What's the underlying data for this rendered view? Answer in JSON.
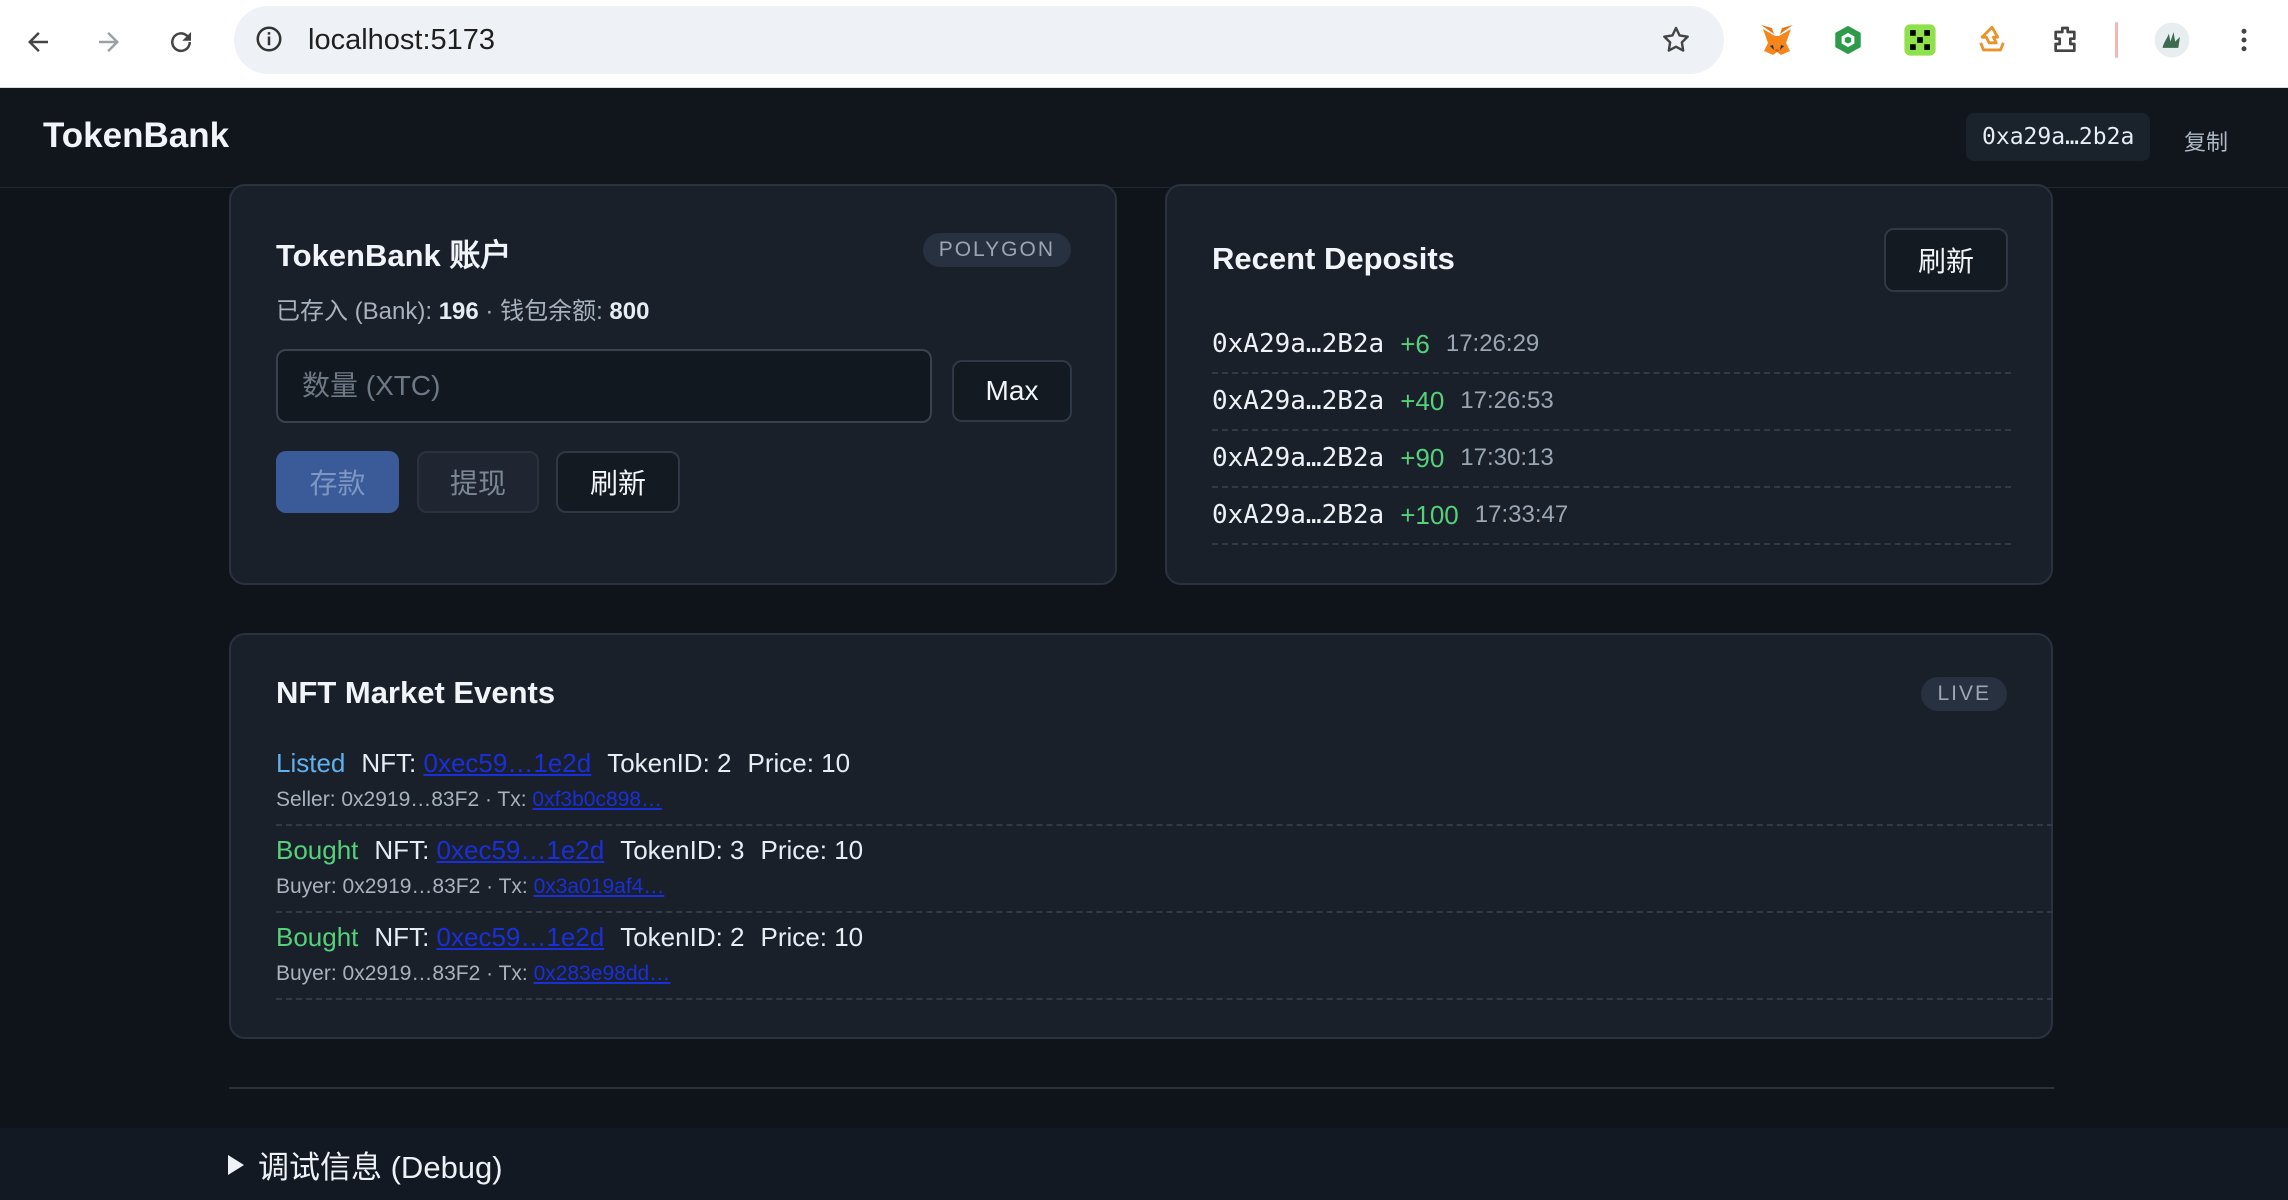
{
  "browser": {
    "url": "localhost:5173"
  },
  "header": {
    "brand": "TokenBank",
    "address": "0xa29a…2b2a",
    "copy_label": "复制"
  },
  "account": {
    "title": "TokenBank 账户",
    "network_badge": "POLYGON",
    "balance_prefix": "已存入 (Bank): ",
    "bank_amount": "196",
    "balance_separator": " · 钱包余额: ",
    "wallet_amount": "800",
    "amount_placeholder": "数量 (XTC)",
    "max_label": "Max",
    "deposit_label": "存款",
    "withdraw_label": "提现",
    "refresh_label": "刷新"
  },
  "deposits": {
    "title": "Recent Deposits",
    "refresh_label": "刷新",
    "items": [
      {
        "address": "0xA29a…2B2a",
        "amount": "+6",
        "time": "17:26:29"
      },
      {
        "address": "0xA29a…2B2a",
        "amount": "+40",
        "time": "17:26:53"
      },
      {
        "address": "0xA29a…2B2a",
        "amount": "+90",
        "time": "17:30:13"
      },
      {
        "address": "0xA29a…2B2a",
        "amount": "+100",
        "time": "17:33:47"
      }
    ]
  },
  "nft": {
    "title": "NFT Market Events",
    "status_badge": "LIVE",
    "events": [
      {
        "type": "Listed",
        "nft_label": "NFT:",
        "nft_addr": "0xec59…1e2d",
        "token": "TokenID: 2",
        "price": "Price: 10",
        "party": "Seller: 0x2919…83F2 · Tx:",
        "tx": "0xf3b0c898…"
      },
      {
        "type": "Bought",
        "nft_label": "NFT:",
        "nft_addr": "0xec59…1e2d",
        "token": "TokenID: 3",
        "price": "Price: 10",
        "party": "Buyer: 0x2919…83F2 · Tx:",
        "tx": "0x3a019af4…"
      },
      {
        "type": "Bought",
        "nft_label": "NFT:",
        "nft_addr": "0xec59…1e2d",
        "token": "TokenID: 2",
        "price": "Price: 10",
        "party": "Buyer: 0x2919…83F2 · Tx:",
        "tx": "0x283e98dd…"
      }
    ]
  },
  "debug": {
    "summary": "调试信息 (Debug)"
  },
  "colors": {
    "background": "#0f141b",
    "card": "#1a202a",
    "accent_green": "#54d179",
    "accent_blue": "#60b0ee",
    "primary_button": "#3a5a98"
  }
}
